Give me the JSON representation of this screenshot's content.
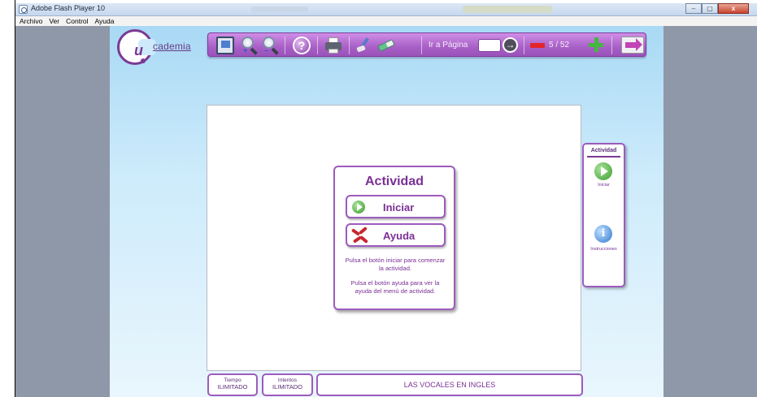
{
  "window": {
    "title": "Adobe Flash Player 10",
    "controls": [
      "–",
      "▢",
      "x"
    ]
  },
  "menu": {
    "items": [
      "Archivo",
      "Ver",
      "Control",
      "Ayuda"
    ]
  },
  "logo": {
    "letter": "u",
    "wordmark": "cademia"
  },
  "toolbar": {
    "help_glyph": "?",
    "goto_label": "Ir a Página",
    "goto_value": "",
    "go_glyph": "→",
    "page_count": "5 / 52",
    "icons": [
      "monitor-icon",
      "zoom-in-icon",
      "zoom-out-icon",
      "help-icon",
      "printer-icon",
      "brush-icon",
      "eraser-icon",
      "go-arrow-icon",
      "minus-icon",
      "plus-icon",
      "exit-icon"
    ]
  },
  "activity": {
    "heading": "Actividad",
    "start_label": "Iniciar",
    "help_label": "Ayuda",
    "info_start": "Pulsa el botón iniciar para comenzar la actividad.",
    "info_help": "Pulsa el botón ayuda para ver la ayuda del menú de actividad."
  },
  "sidepanel": {
    "title": "Actividad",
    "start_label": "Iniciar",
    "info_glyph": "i",
    "instructions_label": "Instrucciones"
  },
  "status": {
    "time_label": "Tiempo",
    "time_value": "ILIMITADO",
    "attempts_label": "Intentos",
    "attempts_value": "ILIMITADO",
    "title": "LAS VOCALES EN INGLES"
  },
  "colors": {
    "brand_purple": "#7a2f96",
    "toolbar_purple": "#a860c7",
    "sky_blue": "#a9d9f5",
    "stage_gray": "#8f98a8",
    "go_green": "#45b640",
    "stop_red": "#e2262c"
  }
}
